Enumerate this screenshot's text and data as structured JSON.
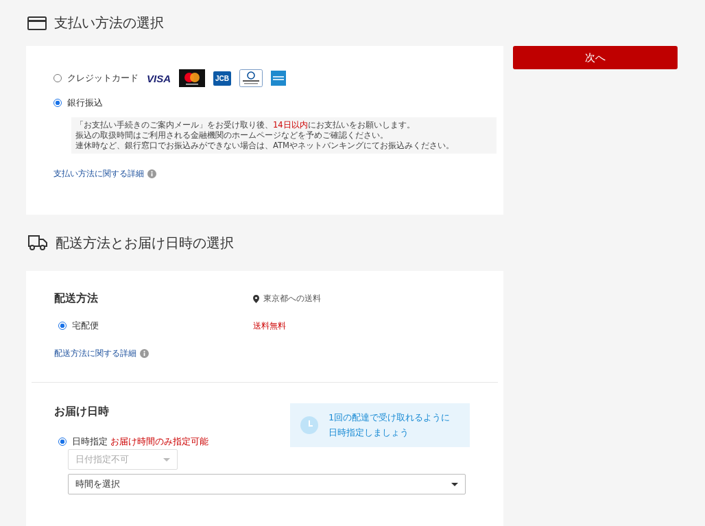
{
  "payment": {
    "heading": "支払い方法の選択",
    "options": [
      {
        "label": "クレジットカード",
        "selected": false,
        "cards": [
          {
            "kind": "visa",
            "label": "VISA"
          },
          {
            "kind": "mastercard"
          },
          {
            "kind": "jcb",
            "label": "JCB"
          },
          {
            "kind": "diners"
          },
          {
            "kind": "amex"
          }
        ]
      },
      {
        "label": "銀行振込",
        "selected": true
      }
    ],
    "note": [
      [
        {
          "text": "「お支払い手続きのご案内メール」をお受け取り後、",
          "highlight": false
        },
        {
          "text": "14日以内",
          "highlight": true
        },
        {
          "text": "にお支払いをお願いします。",
          "highlight": false
        }
      ],
      [
        {
          "text": "振込の取扱時間はご利用される金融機関のホームページなどを予めご確認ください。",
          "highlight": false
        }
      ],
      [
        {
          "text": "連休時など、銀行窓口でお振込みができない場合は、ATMやネットバンキングにてお振込みください。",
          "highlight": false
        }
      ]
    ],
    "details_link": "支払い方法に関する詳細"
  },
  "next_button": "次へ",
  "shipping": {
    "heading": "配送方法とお届け日時の選択",
    "method_title": "配送方法",
    "destination": "東京都への送料",
    "methods": [
      {
        "label": "宅配便",
        "selected": true,
        "fee": "送料無料"
      }
    ],
    "details_link": "配送方法に関する詳細",
    "datetime_title": "お届け日時",
    "tip": [
      "1回の配達で受け取れるように",
      "日時指定しましょう"
    ],
    "datetime_options": [
      {
        "label": "日時指定",
        "selected": true,
        "note": "お届け時間のみ指定可能"
      }
    ],
    "date_select": {
      "value": "日付指定不可",
      "disabled": true
    },
    "time_select": {
      "value": "時間を選択",
      "disabled": false
    }
  }
}
